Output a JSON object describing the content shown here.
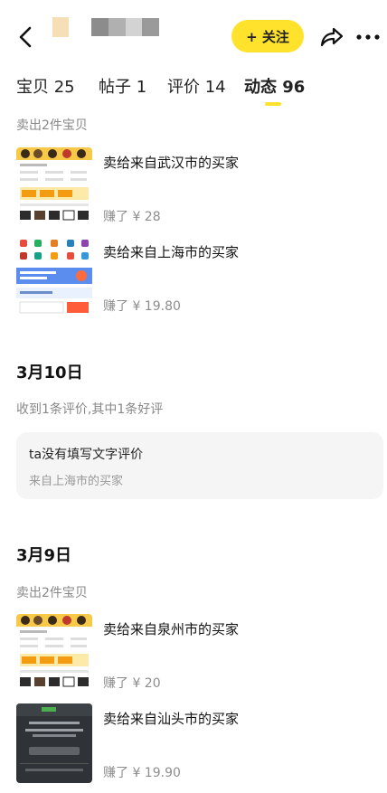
{
  "header": {
    "follow_label": "+ 关注"
  },
  "tabs": [
    {
      "label": "宝贝 25"
    },
    {
      "label": "帖子 1"
    },
    {
      "label": "评价 14"
    },
    {
      "label": "动态 96"
    }
  ],
  "feed": {
    "group1": {
      "summary": "卖出2件宝贝",
      "items": [
        {
          "title": "卖给来自武汉市的买家",
          "price": "赚了 ¥ 28"
        },
        {
          "title": "卖给来自上海市的买家",
          "price": "赚了 ¥ 19.80"
        }
      ]
    },
    "day2": {
      "date": "3月10日",
      "summary": "收到1条评价,其中1条好评",
      "review_text": "ta没有填写文字评价",
      "review_from": "来自上海市的买家"
    },
    "day3": {
      "date": "3月9日",
      "summary": "卖出2件宝贝",
      "items": [
        {
          "title": "卖给来自泉州市的买家",
          "price": "赚了 ¥ 20"
        },
        {
          "title": "卖给来自汕头市的买家",
          "price": "赚了 ¥ 19.90"
        }
      ]
    }
  },
  "colors": {
    "accent": "#ffe22b",
    "muted_text": "#888888",
    "card_bg": "#f5f5f5"
  }
}
